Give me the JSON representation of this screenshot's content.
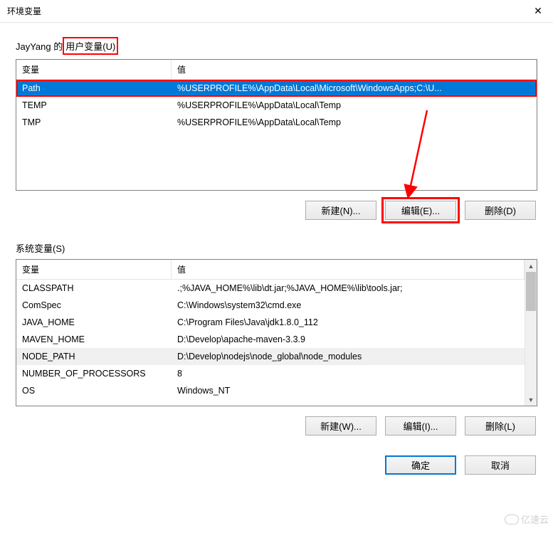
{
  "window": {
    "title": "环境变量"
  },
  "user_section": {
    "label_prefix": "JayYang 的",
    "label_highlight": "用户变量(U)",
    "columns": {
      "var": "变量",
      "val": "值"
    },
    "rows": [
      {
        "var": "Path",
        "val": "%USERPROFILE%\\AppData\\Local\\Microsoft\\WindowsApps;C:\\U...",
        "selected": true
      },
      {
        "var": "TEMP",
        "val": "%USERPROFILE%\\AppData\\Local\\Temp"
      },
      {
        "var": "TMP",
        "val": "%USERPROFILE%\\AppData\\Local\\Temp"
      }
    ],
    "buttons": {
      "new": "新建(N)...",
      "edit": "编辑(E)...",
      "delete": "删除(D)"
    }
  },
  "system_section": {
    "label": "系统变量(S)",
    "columns": {
      "var": "变量",
      "val": "值"
    },
    "rows": [
      {
        "var": "CLASSPATH",
        "val": ".;%JAVA_HOME%\\lib\\dt.jar;%JAVA_HOME%\\lib\\tools.jar;"
      },
      {
        "var": "ComSpec",
        "val": "C:\\Windows\\system32\\cmd.exe"
      },
      {
        "var": "JAVA_HOME",
        "val": "C:\\Program Files\\Java\\jdk1.8.0_112"
      },
      {
        "var": "MAVEN_HOME",
        "val": "D:\\Develop\\apache-maven-3.3.9"
      },
      {
        "var": "NODE_PATH",
        "val": "D:\\Develop\\nodejs\\node_global\\node_modules",
        "highlighted": true
      },
      {
        "var": "NUMBER_OF_PROCESSORS",
        "val": "8"
      },
      {
        "var": "OS",
        "val": "Windows_NT"
      }
    ],
    "buttons": {
      "new": "新建(W)...",
      "edit": "编辑(I)...",
      "delete": "删除(L)"
    }
  },
  "footer": {
    "ok": "确定",
    "cancel": "取消"
  },
  "watermark": "亿速云"
}
